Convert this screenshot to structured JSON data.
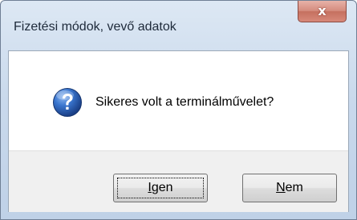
{
  "window": {
    "title": "Fizetési módok, vevő adatok",
    "close_glyph": "x"
  },
  "dialog": {
    "icon": "question-icon",
    "message": "Sikeres volt a terminálművelet?",
    "buttons": {
      "yes": {
        "accel": "I",
        "rest": "gen",
        "focused": true
      },
      "no": {
        "accel": "N",
        "rest": "em",
        "focused": false
      }
    }
  },
  "colors": {
    "icon_blue": "#2a62b8",
    "close_red": "#c5705f"
  }
}
